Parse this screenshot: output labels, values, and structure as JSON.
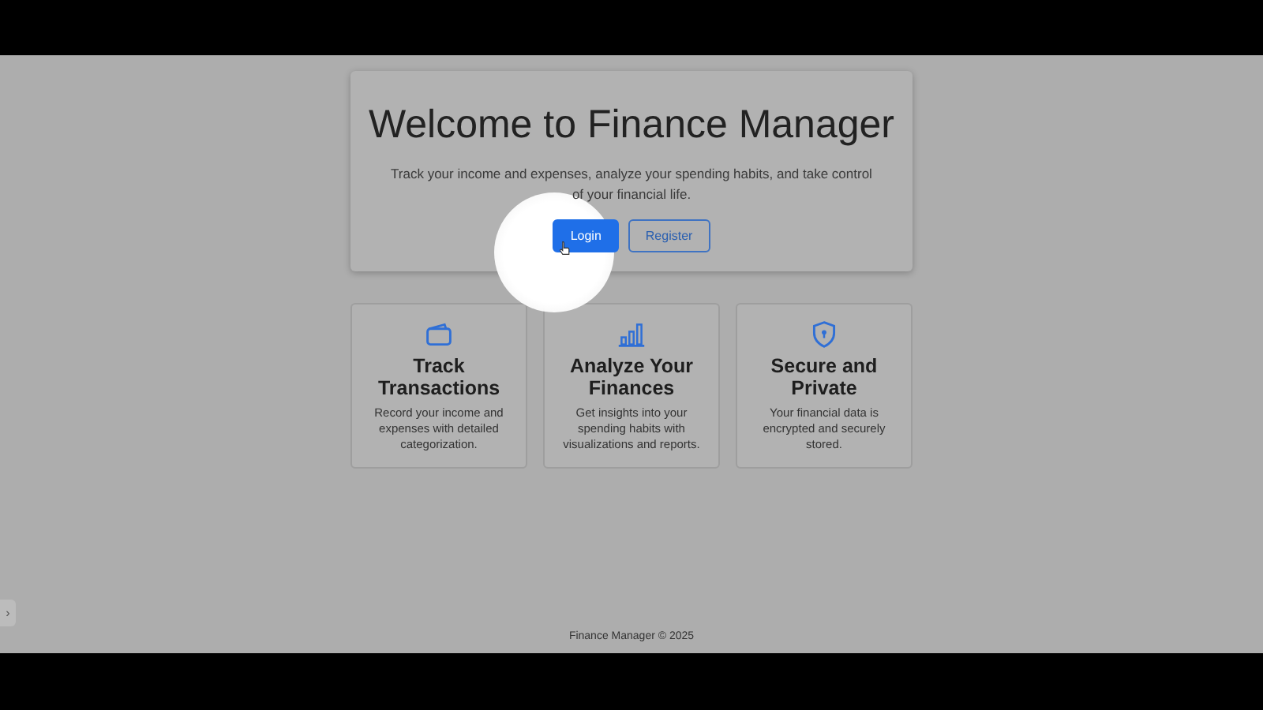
{
  "hero": {
    "title": "Welcome to Finance Manager",
    "subtitle": "Track your income and expenses, analyze your spending habits, and take control of your financial life.",
    "buttons": [
      {
        "label": "Login",
        "kind": "primary",
        "selected": true
      },
      {
        "label": "Register",
        "kind": "outline",
        "selected": false
      }
    ]
  },
  "features": [
    {
      "kind": "wallet",
      "title": "Track Transactions",
      "text": "Record your income and expenses with detailed categorization."
    },
    {
      "kind": "chart",
      "title": "Analyze Your Finances",
      "text": "Get insights into your spending habits with visualizations and reports."
    },
    {
      "kind": "shield",
      "title": "Secure and Private",
      "text": "Your financial data is encrypted and securely stored."
    }
  ],
  "side_tab": {
    "label": "›"
  },
  "footer": "Finance Manager © 2025"
}
